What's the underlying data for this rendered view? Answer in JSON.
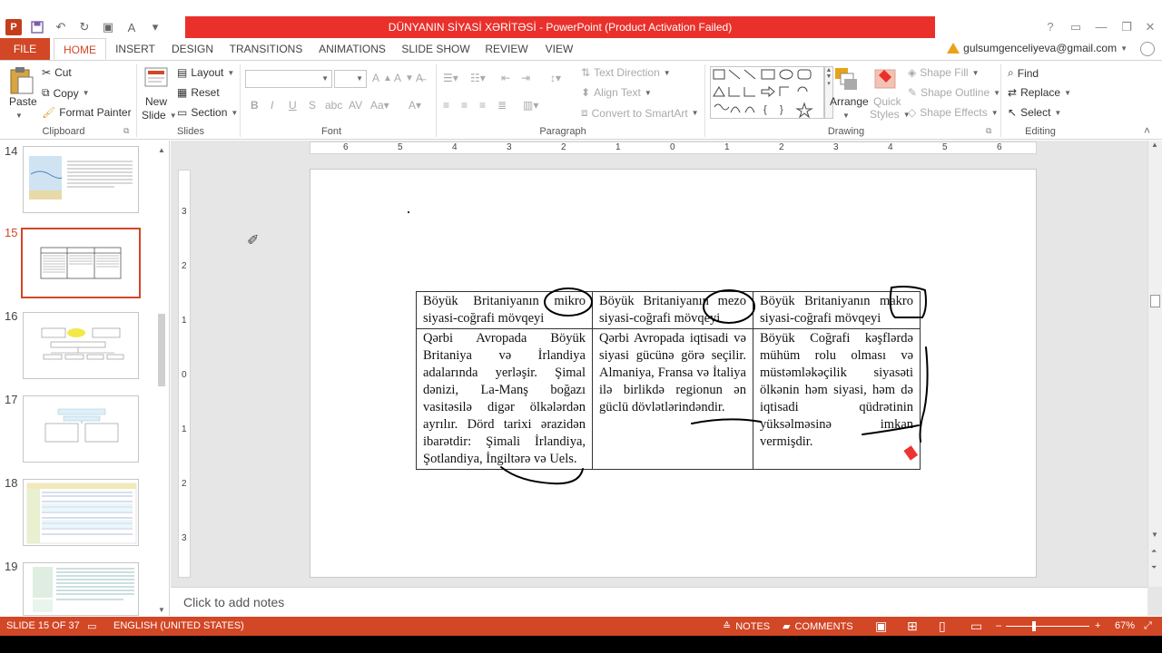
{
  "window": {
    "title": "DÜNYANIN SİYASİ XƏRİTƏSİ - PowerPoint (Product Activation Failed)",
    "controls": [
      "?",
      "restore",
      "minimize",
      "maximize",
      "close"
    ]
  },
  "tabs": [
    {
      "label": "FILE"
    },
    {
      "label": "HOME"
    },
    {
      "label": "INSERT"
    },
    {
      "label": "DESIGN"
    },
    {
      "label": "TRANSITIONS"
    },
    {
      "label": "ANIMATIONS"
    },
    {
      "label": "SLIDE SHOW"
    },
    {
      "label": "REVIEW"
    },
    {
      "label": "VIEW"
    }
  ],
  "account": "gulsumgenceliyeva@gmail.com",
  "ribbon": {
    "clipboard": {
      "label": "Clipboard",
      "paste": "Paste",
      "cut": "Cut",
      "copy": "Copy",
      "format_painter": "Format Painter"
    },
    "slides": {
      "label": "Slides",
      "new_slide_1": "New",
      "new_slide_2": "Slide",
      "layout": "Layout",
      "reset": "Reset",
      "section": "Section"
    },
    "font": {
      "label": "Font"
    },
    "paragraph": {
      "label": "Paragraph",
      "text_direction": "Text Direction",
      "align_text": "Align Text",
      "convert_smartart": "Convert to SmartArt"
    },
    "drawing": {
      "label": "Drawing",
      "arrange": "Arrange",
      "quick_styles_1": "Quick",
      "quick_styles_2": "Styles",
      "shape_fill": "Shape Fill",
      "shape_outline": "Shape Outline",
      "shape_effects": "Shape Effects"
    },
    "editing": {
      "label": "Editing",
      "find": "Find",
      "replace": "Replace",
      "select": "Select"
    }
  },
  "thumbnails": [
    {
      "num": "14"
    },
    {
      "num": "15"
    },
    {
      "num": "16"
    },
    {
      "num": "17"
    },
    {
      "num": "18"
    },
    {
      "num": "19"
    }
  ],
  "ruler": {
    "h": [
      "6",
      "5",
      "4",
      "3",
      "2",
      "1",
      "0",
      "1",
      "2",
      "3",
      "4",
      "5",
      "6"
    ],
    "v": [
      "3",
      "2",
      "1",
      "0",
      "1",
      "2",
      "3"
    ]
  },
  "slide_table": {
    "headers": [
      "Böyük Britaniyanın mikro siyasi-coğrafi mövqeyi",
      "Böyük Britaniyanın mezo siyasi-coğrafi mövqeyi",
      "Böyük Britaniyanın makro siyasi-coğrafi mövqeyi"
    ],
    "cells": [
      "Qərbi Avropada Böyük Britaniya və İrlandiya adalarında yerləşir. Şimal dənizi, La-Manş boğazı vasitəsilə digər ölkələrdən ayrılır. Dörd tarixi ərazidən ibarətdir: Şimali İrlandiya, Şotlandiya, İngiltərə və Uels.",
      "Qərbi Avropada iqtisadi və siyasi gücünə görə seçilir. Almaniya, Fransa və İtaliya ilə birlikdə regionun ən güclü dövlətlərindəndir.",
      "Böyük Coğrafi kəşflərdə mühüm rolu olması və müstəmləkəçilik siyasəti ölkənin həm siyasi, həm də iqtisadi qüdrətinin yüksəlməsinə imkan vermişdir."
    ]
  },
  "notes_placeholder": "Click to add notes",
  "status": {
    "slide": "SLIDE 15 OF 37",
    "language": "ENGLISH (UNITED STATES)",
    "notes": "NOTES",
    "comments": "COMMENTS",
    "zoom": "67%"
  },
  "colors": {
    "accent": "#d24726",
    "title_bar": "#e9302a",
    "ink": "#000000"
  }
}
